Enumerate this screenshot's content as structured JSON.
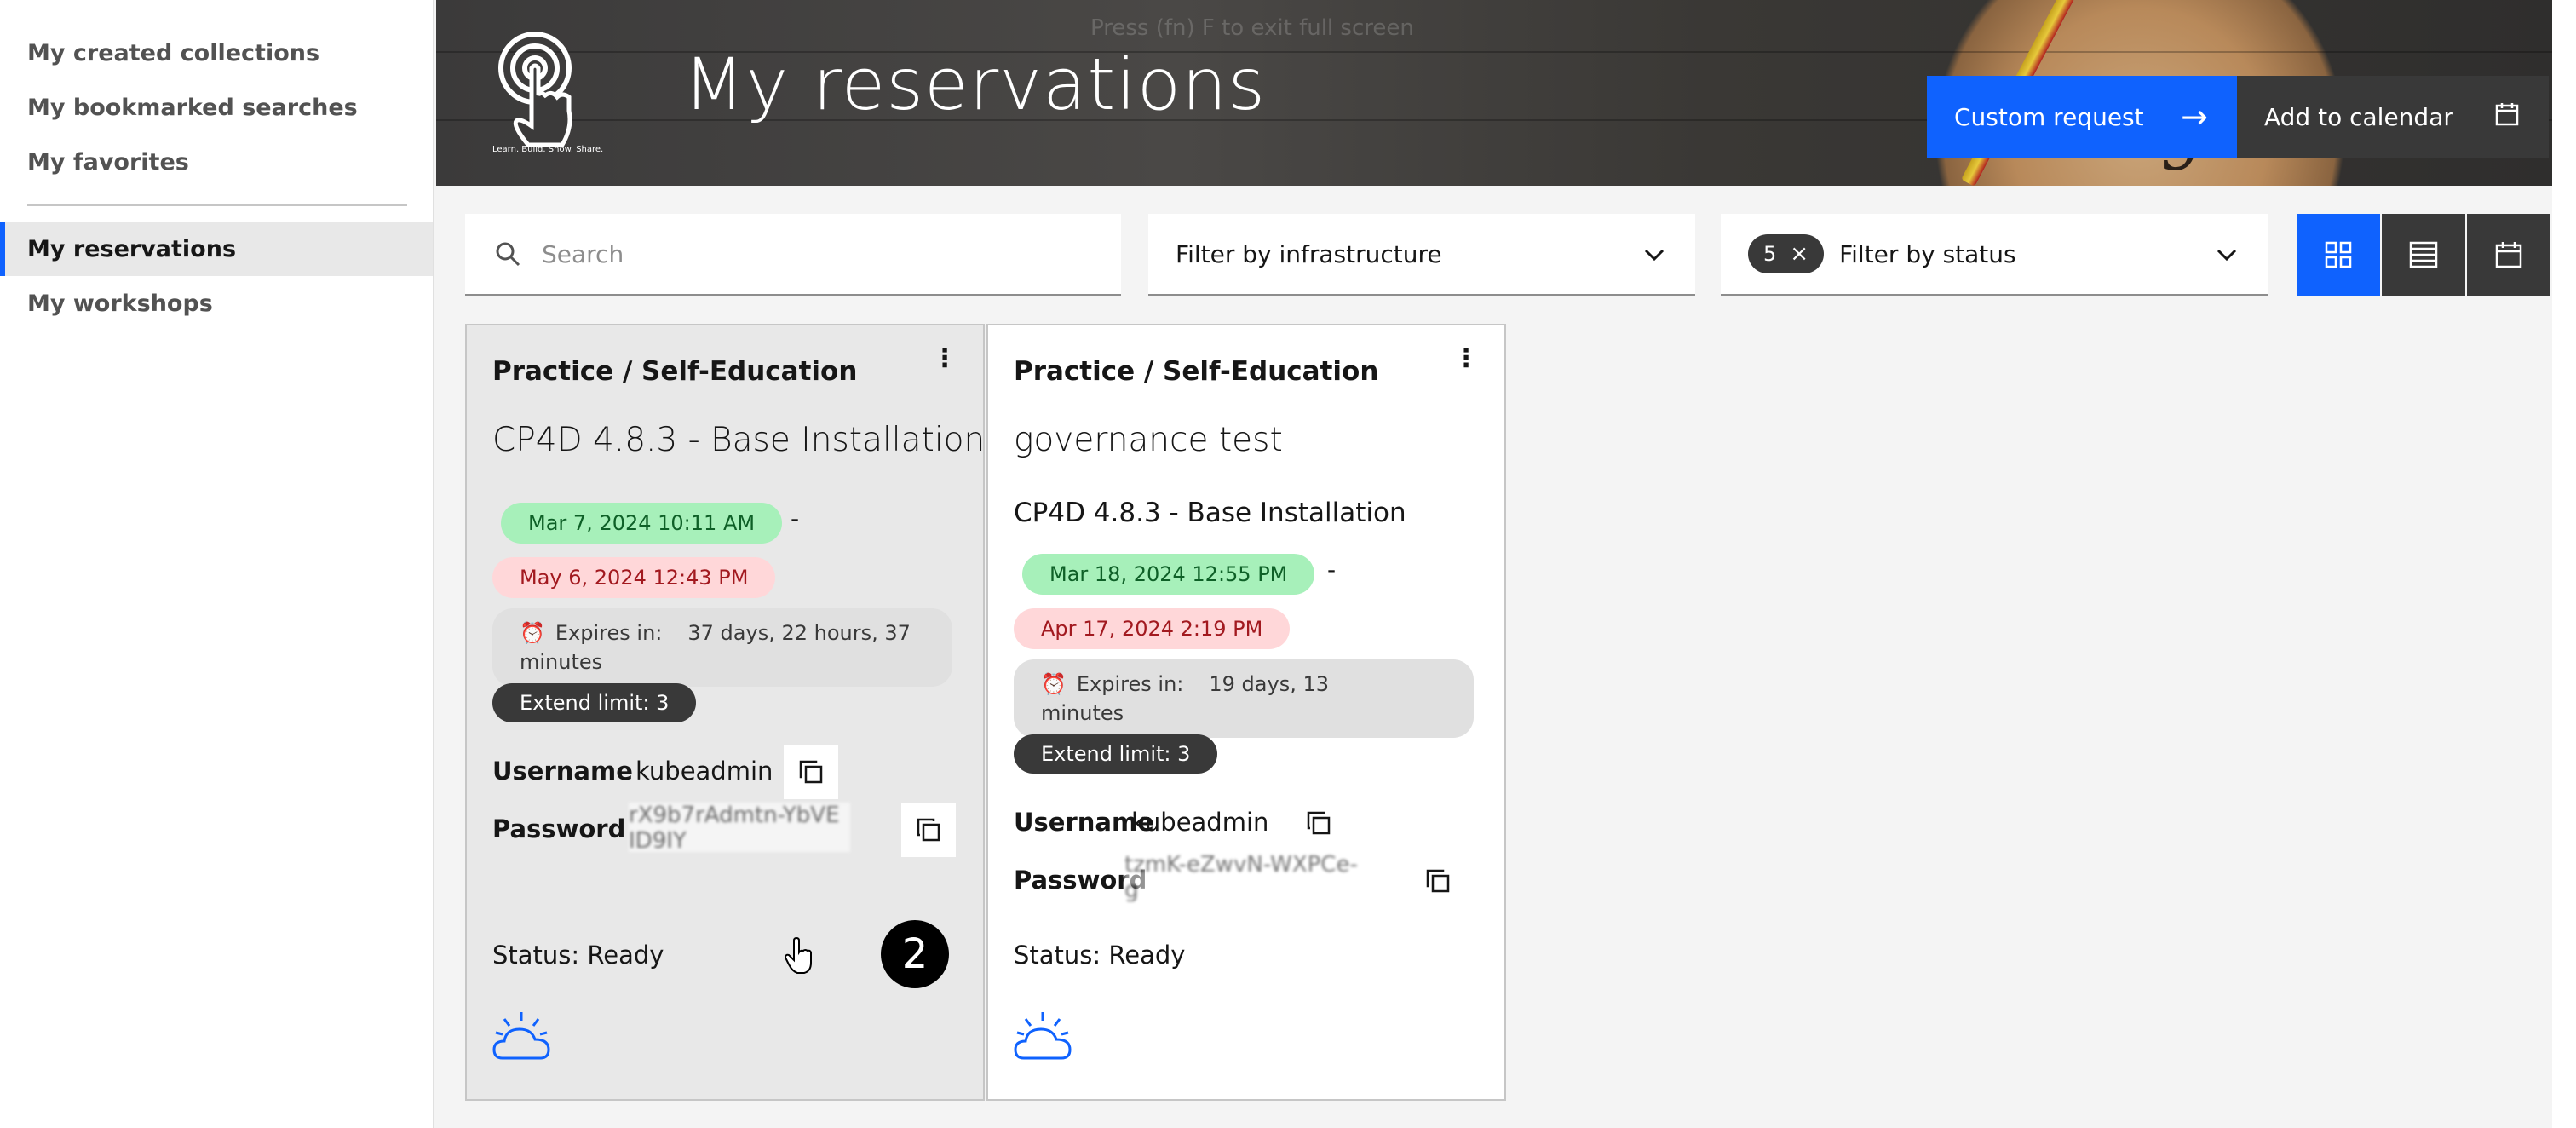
{
  "sidebar": {
    "items": [
      {
        "label": "My created collections"
      },
      {
        "label": "My bookmarked searches"
      },
      {
        "label": "My favorites"
      },
      {
        "label": "My reservations"
      },
      {
        "label": "My workshops"
      }
    ]
  },
  "header": {
    "fullscreen_hint": "Press  (fn) F  to exit full screen",
    "logo_tagline": "Learn. Build. Show. Share.",
    "title": "My reservations",
    "custom_request_label": "Custom request",
    "add_calendar_label": "Add to calendar"
  },
  "filters": {
    "search_placeholder": "Search",
    "infrastructure_label": "Filter by infrastructure",
    "status_count": "5",
    "status_label": "Filter by status"
  },
  "cards": [
    {
      "type": "Practice / Self-Education",
      "title": "CP4D 4.8.3 - Base Installation",
      "start": "Mar 7, 2024 10:11 AM",
      "end": "May 6, 2024 12:43 PM",
      "expires_label": "Expires in:",
      "expires_value": "37 days, 22 hours, 37",
      "expires_tail": "minutes",
      "extend_limit": "Extend limit: 3",
      "username_label": "Username",
      "username": "kubeadmin",
      "password_label": "Password",
      "password_masked": "rX9b7rAdmtn-YbVE",
      "password_masked_2": "ID9IY",
      "status": "Status: Ready"
    },
    {
      "type": "Practice / Self-Education",
      "title": "governance test",
      "subtitle": "CP4D 4.8.3 - Base Installation",
      "start": "Mar 18, 2024 12:55 PM",
      "end": "Apr 17, 2024 2:19 PM",
      "expires_label": "Expires in:",
      "expires_value": "19 days, 13",
      "expires_tail": "minutes",
      "extend_limit": "Extend limit: 3",
      "username_label": "Username",
      "username": "kubeadmin",
      "password_label": "Password",
      "password_masked": "tzmK-eZwvN-WXPCe-",
      "password_masked_2": "g",
      "status": "Status: Ready"
    }
  ],
  "step_badge": "2",
  "colors": {
    "primary": "#0f62fe",
    "dark": "#393939",
    "green_pill": "#a7f0ba",
    "red_pill": "#ffd7d9"
  }
}
